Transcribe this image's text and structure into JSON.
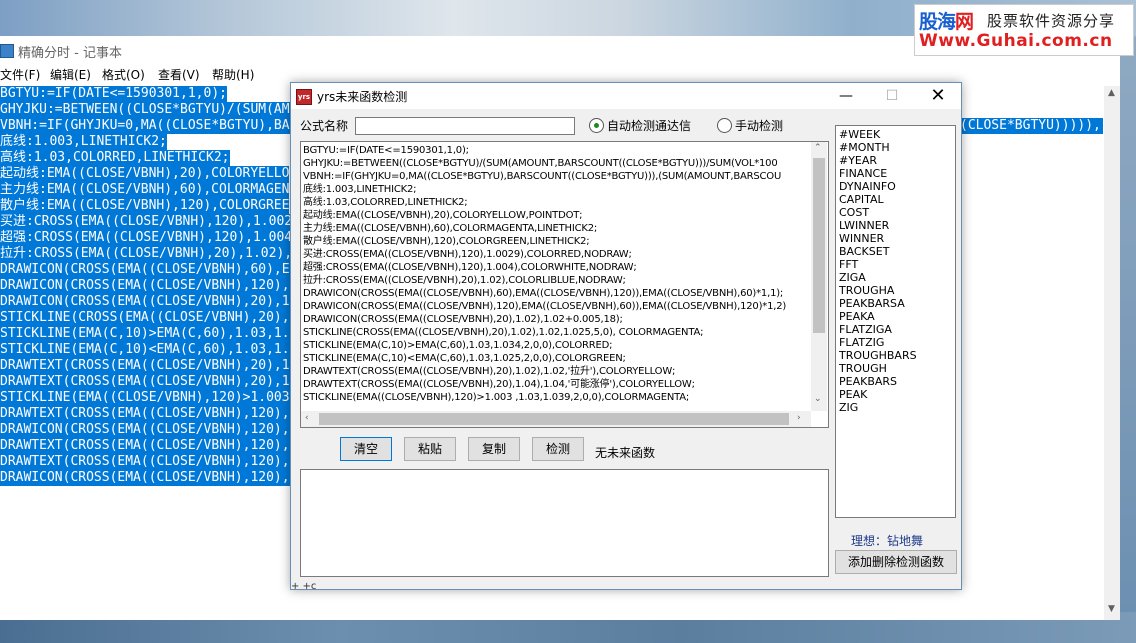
{
  "watermark": {
    "logo_part1": "股海",
    "logo_part2": "网",
    "slogan": "股票软件资源分享",
    "url": "Www.Guhai.com.cn"
  },
  "notepad": {
    "title": "精确分时 - 记事本",
    "menu": [
      "文件(F)",
      "编辑(E)",
      "格式(O)",
      "查看(V)",
      "帮助(H)"
    ],
    "lines": [
      "BGTYU:=IF(DATE<=1590301,1,0);",
      "GHYJKU:=BETWEEN((CLOSE*BGTYU)/(SUM(AMO",
      "VBNH:=IF(GHYJKU=0,MA((CLOSE*BGTYU),BAR",
      "底线:1.003,LINETHICK2;",
      "高线:1.03,COLORRED,LINETHICK2;",
      "起动线:EMA((CLOSE/VBNH),20),COLORYELLO",
      "主力线:EMA((CLOSE/VBNH),60),COLORMAGEN",
      "散户线:EMA((CLOSE/VBNH),120),COLORGREE",
      "买进:CROSS(EMA((CLOSE/VBNH),120),1.002",
      "超强:CROSS(EMA((CLOSE/VBNH),120),1.004",
      "拉升:CROSS(EMA((CLOSE/VBNH),20),1.02),",
      "DRAWICON(CROSS(EMA((CLOSE/VBNH),60),EM",
      "DRAWICON(CROSS(EMA((CLOSE/VBNH),120),E",
      "DRAWICON(CROSS(EMA((CLOSE/VBNH),20),1.",
      "STICKLINE(CROSS(EMA((CLOSE/VBNH),20),1",
      "STICKLINE(EMA(C,10)>EMA(C,60),1.03,1.0",
      "STICKLINE(EMA(C,10)<EMA(C,60),1.03,1.0",
      "DRAWTEXT(CROSS(EMA((CLOSE/VBNH),20),1.",
      "DRAWTEXT(CROSS(EMA((CLOSE/VBNH),20),1.",
      "STICKLINE(EMA((CLOSE/VBNH),120)>1.003",
      "DRAWTEXT(CROSS(EMA((CLOSE/VBNH),120),",
      "DRAWICON(CROSS(EMA((CLOSE/VBNH),120),",
      "DRAWTEXT(CROSS(EMA((CLOSE/VBNH),120),",
      "DRAWTEXT(CROSS(EMA((CLOSE/VBNH),120),",
      "DRAWICON(CROSS(EMA((CLOSE/VBNH),120),"
    ],
    "line_right_fragment": "(CLOSE*BGTYU))))),"
  },
  "dialog": {
    "title": "yrs未来函数检测",
    "icon_text": "yrs",
    "formula_name_label": "公式名称",
    "formula_name_value": "",
    "radio_auto": "自动检测通达信",
    "radio_manual": "手动检测",
    "radio_selected": "auto",
    "code": [
      "BGTYU:=IF(DATE<=1590301,1,0);",
      "GHYJKU:=BETWEEN((CLOSE*BGTYU)/(SUM(AMOUNT,BARSCOUNT((CLOSE*BGTYU)))/SUM(VOL*100",
      "VBNH:=IF(GHYJKU=0,MA((CLOSE*BGTYU),BARSCOUNT((CLOSE*BGTYU))),(SUM(AMOUNT,BARSCOU",
      "底线:1.003,LINETHICK2;",
      "高线:1.03,COLORRED,LINETHICK2;",
      "起动线:EMA((CLOSE/VBNH),20),COLORYELLOW,POINTDOT;",
      "主力线:EMA((CLOSE/VBNH),60),COLORMAGENTA,LINETHICK2;",
      "散户线:EMA((CLOSE/VBNH),120),COLORGREEN,LINETHICK2;",
      "买进:CROSS(EMA((CLOSE/VBNH),120),1.0029),COLORRED,NODRAW;",
      "超强:CROSS(EMA((CLOSE/VBNH),120),1.004),COLORWHITE,NODRAW;",
      "拉升:CROSS(EMA((CLOSE/VBNH),20),1.02),COLORLIBLUE,NODRAW;",
      "DRAWICON(CROSS(EMA((CLOSE/VBNH),60),EMA((CLOSE/VBNH),120)),EMA((CLOSE/VBNH),60)*1,1);",
      "DRAWICON(CROSS(EMA((CLOSE/VBNH),120),EMA((CLOSE/VBNH),60)),EMA((CLOSE/VBNH),120)*1,2)",
      "DRAWICON(CROSS(EMA((CLOSE/VBNH),20),1.02),1.02+0.005,18);",
      "STICKLINE(CROSS(EMA((CLOSE/VBNH),20),1.02),1.02,1.025,5,0), COLORMAGENTA;",
      "STICKLINE(EMA(C,10)>EMA(C,60),1.03,1.034,2,0,0),COLORRED;",
      "STICKLINE(EMA(C,10)<EMA(C,60),1.03,1.025,2,0,0),COLORGREEN;",
      "DRAWTEXT(CROSS(EMA((CLOSE/VBNH),20),1.02),1.02,'拉升'),COLORYELLOW;",
      "DRAWTEXT(CROSS(EMA((CLOSE/VBNH),20),1.04),1.04,'可能涨停'),COLORYELLOW;",
      "STICKLINE(EMA((CLOSE/VBNH),120)>1.003 ,1.03,1.039,2,0,0),COLORMAGENTA;"
    ],
    "buttons": {
      "clear": "清空",
      "paste": "粘贴",
      "copy": "复制",
      "check": "检测"
    },
    "status": "无未来函数",
    "functions": [
      "#WEEK",
      "#MONTH",
      "#YEAR",
      "FINANCE",
      "DYNAINFO",
      "CAPITAL",
      "COST",
      "LWINNER",
      "WINNER",
      "BACKSET",
      "FFT",
      "ZIGA",
      "TROUGHA",
      "PEAKBARSA",
      "PEAKA",
      "FLATZIGA",
      "FLATZIG",
      "TROUGHBARS",
      "TROUGH",
      "PEAKBARS",
      "PEAK",
      "ZIG"
    ],
    "ideal_label": "理想：钻地舞",
    "add_delete_button": "添加删除检测函数",
    "bottom_fragment": "+ +c"
  },
  "icons": {
    "minimize": "minimize-icon",
    "maximize": "maximize-icon",
    "close": "close-icon"
  },
  "colors": {
    "selection": "#0078d7",
    "watermark_blue": "#1a5fd0",
    "watermark_red": "#e02020"
  }
}
